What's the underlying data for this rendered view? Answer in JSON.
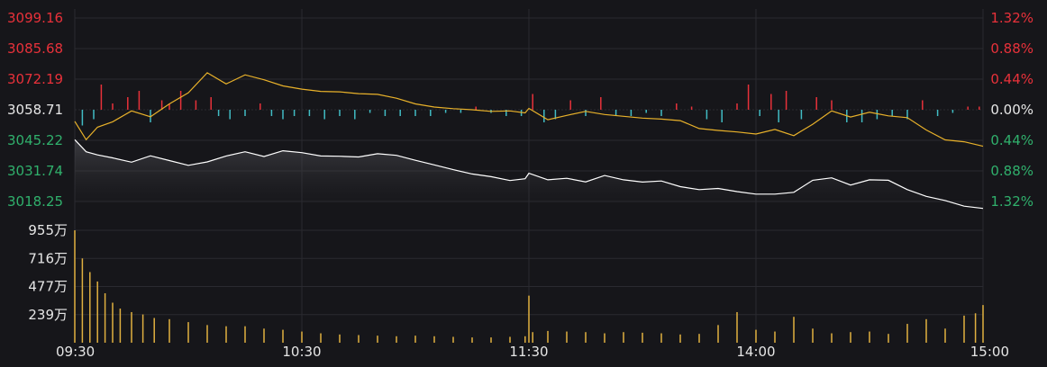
{
  "colors": {
    "background": "#16161a",
    "grid": "#2a2a30",
    "up": "#e8313a",
    "down": "#30b06c",
    "neutral": "#e6e6e6",
    "price_line": "#ffffff",
    "avg_line": "#e8b12a",
    "rise_bar": "#e8313a",
    "fall_bar": "#41bcc4",
    "volume_bar": "#e0b040"
  },
  "chart_data": {
    "type": "line",
    "price_axis": {
      "labels": [
        "3099.16",
        "3085.68",
        "3072.19",
        "3058.71",
        "3045.22",
        "3031.74",
        "3018.25"
      ],
      "label_colors": [
        "up",
        "up",
        "up",
        "neutral",
        "down",
        "down",
        "down"
      ],
      "ylim": [
        3018.25,
        3099.16
      ],
      "base": 3058.71
    },
    "pct_axis": {
      "labels": [
        "1.32%",
        "0.88%",
        "0.44%",
        "0.00%",
        "0.44%",
        "0.88%",
        "1.32%"
      ],
      "label_colors": [
        "up",
        "up",
        "up",
        "neutral",
        "down",
        "down",
        "down"
      ]
    },
    "volume_axis": {
      "labels": [
        "955万",
        "716万",
        "477万",
        "239万"
      ],
      "ylim": [
        0,
        955
      ]
    },
    "time_labels": [
      "09:30",
      "10:30",
      "11:30",
      "14:00",
      "15:00"
    ],
    "series": [
      {
        "x": [
          0,
          3,
          6,
          10,
          15,
          20,
          25,
          30,
          35,
          40,
          45,
          50,
          55,
          60,
          65,
          70,
          75,
          80,
          85,
          90,
          95,
          100,
          105,
          110,
          115,
          119,
          120,
          125,
          130,
          135,
          140,
          145,
          150,
          155,
          160,
          165,
          170,
          175,
          180,
          185,
          190,
          195,
          200,
          205,
          210,
          215,
          220,
          225,
          230,
          235,
          240
        ],
        "values": [
          3045.5,
          3040.2,
          3038.8,
          3037.5,
          3035.6,
          3038.4,
          3036.3,
          3034.2,
          3035.7,
          3038.3,
          3040.2,
          3038.1,
          3040.6,
          3039.8,
          3038.3,
          3038.2,
          3037.9,
          3039.3,
          3038.6,
          3036.4,
          3034.4,
          3032.3,
          3030.4,
          3029.2,
          3027.5,
          3028.3,
          3030.7,
          3027.8,
          3028.5,
          3026.9,
          3029.7,
          3027.8,
          3026.8,
          3027.3,
          3024.8,
          3023.5,
          3024.0,
          3022.6,
          3021.5,
          3021.5,
          3022.3,
          3027.6,
          3028.7,
          3025.5,
          3027.8,
          3027.6,
          3023.5,
          3020.5,
          3018.7,
          3016.2,
          3015.2
        ]
      },
      {
        "x": [
          0,
          3,
          6,
          10,
          15,
          20,
          25,
          30,
          35,
          40,
          45,
          50,
          55,
          60,
          65,
          70,
          75,
          80,
          85,
          90,
          95,
          100,
          105,
          110,
          115,
          119,
          120,
          125,
          130,
          135,
          140,
          145,
          150,
          155,
          160,
          165,
          170,
          175,
          180,
          185,
          190,
          195,
          200,
          205,
          210,
          215,
          220,
          225,
          230,
          235,
          240
        ],
        "values": [
          3053.6,
          3045.5,
          3051.0,
          3053.4,
          3058.2,
          3055.6,
          3061.3,
          3066.2,
          3075.0,
          3070.1,
          3074.1,
          3071.9,
          3069.2,
          3067.8,
          3066.8,
          3066.6,
          3065.8,
          3065.5,
          3063.8,
          3061.3,
          3059.9,
          3059.2,
          3058.7,
          3058.0,
          3058.2,
          3057.3,
          3059.3,
          3054.3,
          3056.2,
          3058.0,
          3056.6,
          3055.8,
          3055.0,
          3054.6,
          3053.9,
          3050.4,
          3049.6,
          3048.9,
          3048.0,
          3050.0,
          3047.3,
          3052.3,
          3058.2,
          3055.5,
          3057.6,
          3056.0,
          3055.2,
          3049.8,
          3045.4,
          3044.6,
          3042.6
        ]
      }
    ],
    "volume": {
      "x": [
        0,
        2,
        4,
        6,
        8,
        10,
        12,
        15,
        18,
        21,
        25,
        30,
        35,
        40,
        45,
        50,
        55,
        60,
        65,
        70,
        75,
        80,
        85,
        90,
        95,
        100,
        105,
        110,
        115,
        119,
        120,
        121,
        125,
        130,
        135,
        140,
        145,
        150,
        155,
        160,
        165,
        170,
        175,
        180,
        185,
        190,
        195,
        200,
        205,
        210,
        215,
        220,
        225,
        230,
        235,
        238,
        240
      ],
      "values": [
        955,
        716,
        600,
        520,
        420,
        340,
        290,
        260,
        240,
        210,
        200,
        175,
        150,
        140,
        140,
        120,
        110,
        95,
        80,
        70,
        65,
        60,
        55,
        60,
        55,
        50,
        45,
        45,
        50,
        55,
        400,
        90,
        100,
        95,
        90,
        80,
        90,
        85,
        80,
        70,
        75,
        150,
        260,
        110,
        95,
        220,
        120,
        80,
        90,
        95,
        75,
        160,
        200,
        120,
        230,
        250,
        320
      ]
    },
    "rise_fall_bars": {
      "x": [
        2,
        5,
        7,
        10,
        14,
        17,
        20,
        23,
        25,
        28,
        32,
        36,
        38,
        41,
        45,
        49,
        52,
        55,
        58,
        62,
        66,
        70,
        74,
        78,
        82,
        86,
        90,
        94,
        98,
        102,
        106,
        110,
        114,
        118,
        121,
        124,
        127,
        131,
        135,
        139,
        143,
        147,
        151,
        155,
        159,
        163,
        167,
        171,
        175,
        178,
        181,
        184,
        186,
        188,
        192,
        196,
        200,
        204,
        208,
        212,
        216,
        220,
        224,
        228,
        232,
        236,
        239
      ],
      "values": [
        -5,
        -3,
        8,
        2,
        4,
        6,
        -4,
        3,
        2,
        6,
        3,
        4,
        -2,
        -3,
        -2,
        2,
        -2,
        -3,
        -2,
        -2,
        -3,
        -2,
        -3,
        -1,
        -2,
        -2,
        -2,
        -2,
        -1,
        -1,
        1,
        -1,
        -2,
        -2,
        5,
        -4,
        -3,
        3,
        -2,
        4,
        -2,
        -2,
        -1,
        -2,
        2,
        1,
        -3,
        -4,
        2,
        8,
        -2,
        5,
        -4,
        6,
        -3,
        4,
        3,
        -4,
        -4,
        -3,
        -2,
        -3,
        3,
        -2,
        -1,
        1,
        1
      ]
    }
  }
}
